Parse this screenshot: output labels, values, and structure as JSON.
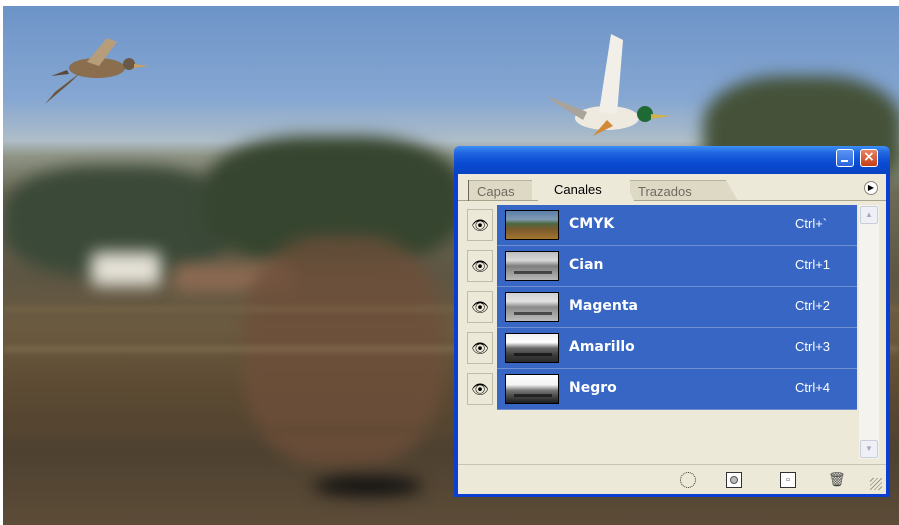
{
  "panel": {
    "tabs": [
      {
        "label": "Capas",
        "active": false
      },
      {
        "label": "Canales",
        "active": true
      },
      {
        "label": "Trazados",
        "active": false
      }
    ],
    "menu_icon": "flyout-menu-icon",
    "channels": [
      {
        "name": "CMYK",
        "shortcut": "Ctrl+`",
        "visible": true,
        "selected": true,
        "thumb": "color"
      },
      {
        "name": "Cian",
        "shortcut": "Ctrl+1",
        "visible": true,
        "selected": true,
        "thumb": "cian"
      },
      {
        "name": "Magenta",
        "shortcut": "Ctrl+2",
        "visible": true,
        "selected": true,
        "thumb": "mag"
      },
      {
        "name": "Amarillo",
        "shortcut": "Ctrl+3",
        "visible": true,
        "selected": true,
        "thumb": "ama"
      },
      {
        "name": "Negro",
        "shortcut": "Ctrl+4",
        "visible": true,
        "selected": true,
        "thumb": "neg"
      }
    ],
    "toolbar_icons": [
      "load-selection-icon",
      "save-selection-icon",
      "new-channel-icon",
      "delete-channel-icon"
    ]
  },
  "colors": {
    "title_bar": "#0a4bd3",
    "selection": "#3766c4",
    "panel_bg": "#ece9d8",
    "close_button": "#c43d14"
  }
}
